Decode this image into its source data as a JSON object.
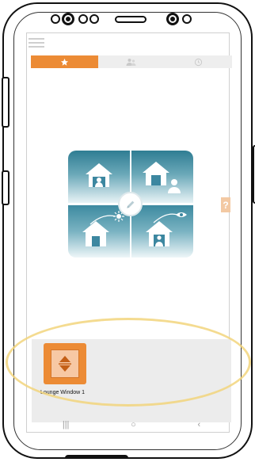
{
  "tabs": [
    {
      "id": "favorites",
      "icon": "star-icon",
      "active": true
    },
    {
      "id": "scenes",
      "icon": "people-icon",
      "active": false
    },
    {
      "id": "timers",
      "icon": "clock-icon",
      "active": false
    }
  ],
  "scenes": [
    {
      "icon": "house-person-icon"
    },
    {
      "icon": "house-leaving-icon"
    },
    {
      "icon": "house-sun-icon"
    },
    {
      "icon": "house-eye-icon"
    }
  ],
  "help": {
    "label": "?"
  },
  "device": {
    "name": "Lounge Window 1",
    "icon": "shutter-updown-icon"
  },
  "nav": {
    "recents": "|||",
    "home": "○",
    "back": "‹"
  },
  "colors": {
    "accent": "#ec8b35",
    "scene_teal": "#2f7d93",
    "highlight": "#f2d57c"
  }
}
